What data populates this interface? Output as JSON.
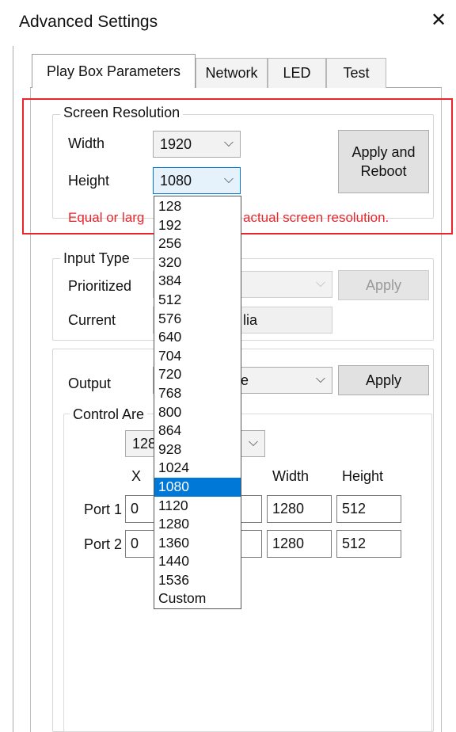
{
  "window": {
    "title": "Advanced Settings",
    "close_glyph": "✕"
  },
  "tabs": [
    {
      "label": "Play Box Parameters"
    },
    {
      "label": "Network"
    },
    {
      "label": "LED"
    },
    {
      "label": "Test"
    }
  ],
  "screen_resolution": {
    "legend": "Screen Resolution",
    "width_label": "Width",
    "width_value": "1920",
    "height_label": "Height",
    "height_value": "1080",
    "apply_button": "Apply and Reboot",
    "warning_left": "Equal or larg",
    "warning_right": "actual screen resolution."
  },
  "input_type": {
    "legend": "Input Type",
    "prioritized_label": "Prioritized",
    "apply_button": "Apply",
    "current_label": "Current",
    "current_value_fragment": "lia"
  },
  "output": {
    "label": "Output",
    "value_fragment": "e",
    "apply_button": "Apply",
    "control_area_legend": "Control Are",
    "control_area_select_fragment": "128",
    "col_x": "X",
    "col_width": "Width",
    "col_height": "Height",
    "ports": [
      {
        "label": "Port 1",
        "x": "0",
        "width": "1280",
        "height": "512"
      },
      {
        "label": "Port 2",
        "x": "0",
        "width": "1280",
        "height": "512"
      }
    ]
  },
  "height_dropdown": {
    "options": [
      "128",
      "192",
      "256",
      "320",
      "384",
      "512",
      "576",
      "640",
      "704",
      "720",
      "768",
      "800",
      "864",
      "928",
      "1024",
      "1080",
      "1120",
      "1280",
      "1360",
      "1440",
      "1536",
      "Custom"
    ],
    "selected": "1080"
  },
  "icons": {
    "chevron": "chevron-down-icon"
  },
  "colors": {
    "highlight_red": "#e8262c",
    "selection_blue": "#0078d7"
  }
}
